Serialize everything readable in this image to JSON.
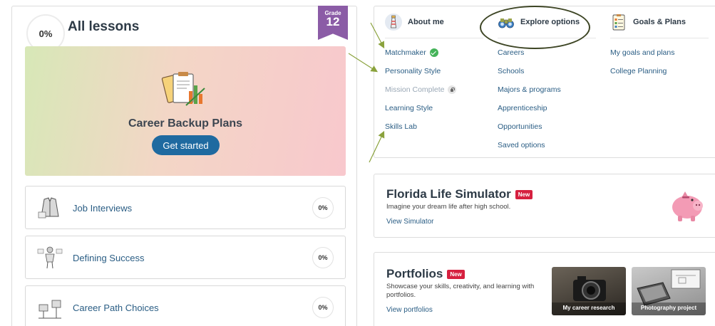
{
  "left": {
    "progress": "0%",
    "title": "All lessons",
    "grade_label": "Grade",
    "grade_value": "12",
    "hero": {
      "title": "Career Backup Plans",
      "button": "Get started"
    },
    "lessons": [
      {
        "title": "Job Interviews",
        "pct": "0%"
      },
      {
        "title": "Defining Success",
        "pct": "0%"
      },
      {
        "title": "Career Path Choices",
        "pct": "0%"
      }
    ]
  },
  "nav": {
    "about": {
      "label": "About me",
      "items": [
        "Matchmaker",
        "Personality Style",
        "Mission Complete",
        "Learning Style",
        "Skills Lab"
      ]
    },
    "explore": {
      "label": "Explore options",
      "items": [
        "Careers",
        "Schools",
        "Majors & programs",
        "Apprenticeship",
        "Opportunities",
        "Saved options"
      ]
    },
    "goals": {
      "label": "Goals & Plans",
      "items": [
        "My goals and plans",
        "College Planning"
      ]
    }
  },
  "simulator": {
    "title": "Florida Life Simulator",
    "badge": "New",
    "description": "Imagine your dream life after high school.",
    "link": "View Simulator"
  },
  "portfolios": {
    "title": "Portfolios",
    "badge": "New",
    "description": "Showcase your skills, creativity, and learning with portfolios.",
    "link": "View portfolios",
    "thumbs": [
      "My career research",
      "Photography project"
    ]
  },
  "colors": {
    "accent_blue": "#1f6aa0",
    "link": "#2a5d84",
    "grade_purple": "#8b5ca6",
    "new_red": "#d6203f",
    "check_green": "#45b359",
    "annotation_arrow": "#8aa23c"
  }
}
